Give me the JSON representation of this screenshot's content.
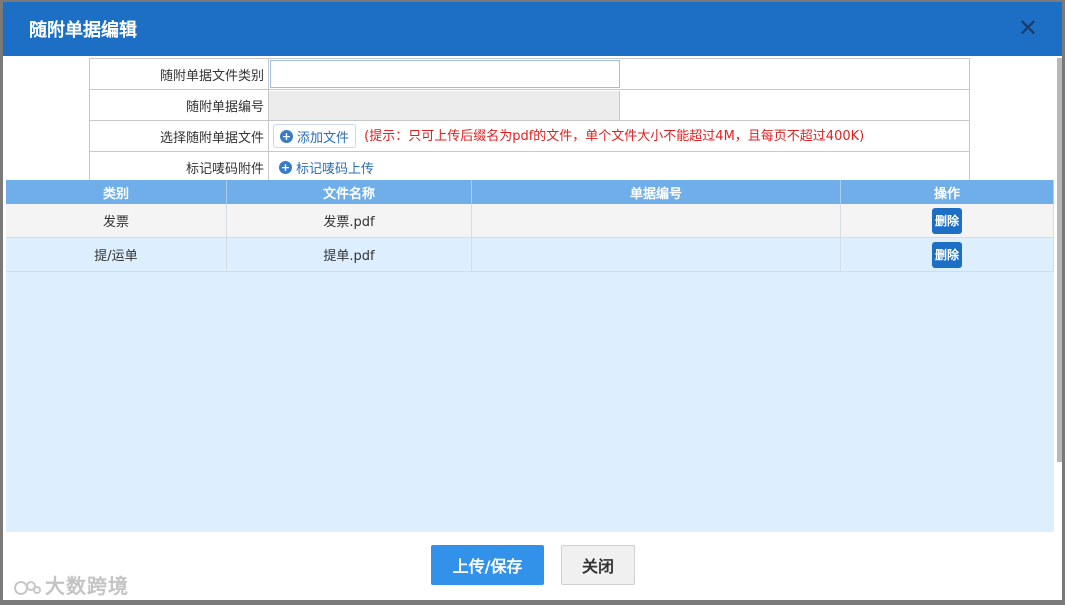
{
  "dialog": {
    "title": "随附单据编辑",
    "close_icon": "close-icon"
  },
  "form": {
    "category_label": "随附单据文件类别",
    "category_value": "",
    "number_label": "随附单据编号",
    "number_value": "",
    "file_label": "选择随附单据文件",
    "add_file_label": "添加文件",
    "hint": "(提示：只可上传后缀名为pdf的文件，单个文件大小不能超过4M，且每页不超过400K)",
    "mark_label": "标记唛码附件",
    "mark_upload_label": "标记唛码上传"
  },
  "grid": {
    "columns": [
      "类别",
      "文件名称",
      "单据编号",
      "操作"
    ],
    "rows": [
      {
        "category": "发票",
        "file_name": "发票.pdf",
        "doc_no": "",
        "action": "删除"
      },
      {
        "category": "提/运单",
        "file_name": "提单.pdf",
        "doc_no": "",
        "action": "删除"
      }
    ]
  },
  "footer": {
    "save_label": "上传/保存",
    "close_label": "关闭"
  },
  "watermark": {
    "text": "大数跨境"
  },
  "colors": {
    "title_bar": "#1c6fc5",
    "header_row": "#6faee8",
    "primary_button": "#3292ea",
    "hint_text": "#e02020"
  }
}
